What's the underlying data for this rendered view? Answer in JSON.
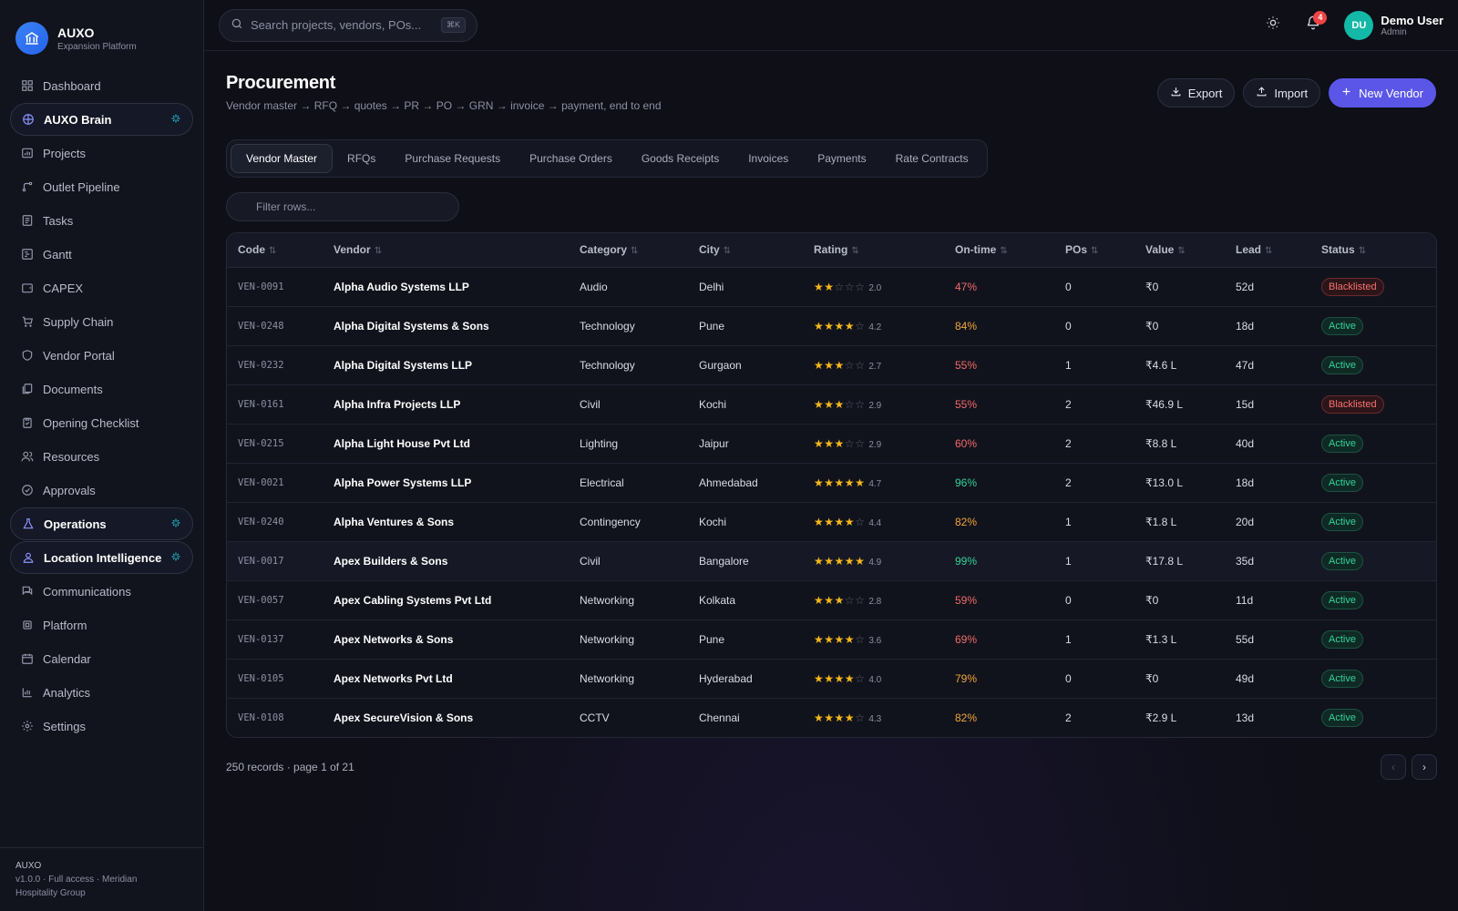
{
  "brand": {
    "name": "AUXO",
    "subtitle": "Expansion Platform"
  },
  "sidebar": {
    "items": [
      {
        "label": "Dashboard",
        "icon": "grid-icon"
      },
      {
        "label": "AUXO Brain",
        "icon": "brain-icon",
        "accent": true
      },
      {
        "label": "Projects",
        "icon": "projects-icon"
      },
      {
        "label": "Outlet Pipeline",
        "icon": "pipeline-icon"
      },
      {
        "label": "Tasks",
        "icon": "tasks-icon"
      },
      {
        "label": "Gantt",
        "icon": "gantt-icon"
      },
      {
        "label": "CAPEX",
        "icon": "wallet-icon"
      },
      {
        "label": "Supply Chain",
        "icon": "cart-icon"
      },
      {
        "label": "Vendor Portal",
        "icon": "shield-icon"
      },
      {
        "label": "Documents",
        "icon": "documents-icon"
      },
      {
        "label": "Opening Checklist",
        "icon": "clipboard-icon"
      },
      {
        "label": "Resources",
        "icon": "users-icon"
      },
      {
        "label": "Approvals",
        "icon": "check-circle-icon"
      },
      {
        "label": "Operations",
        "icon": "flask-icon",
        "accent": true
      },
      {
        "label": "Location Intelligence",
        "icon": "user-pin-icon",
        "accent": true
      },
      {
        "label": "Communications",
        "icon": "chat-icon"
      },
      {
        "label": "Platform",
        "icon": "chip-icon"
      },
      {
        "label": "Calendar",
        "icon": "calendar-icon"
      },
      {
        "label": "Analytics",
        "icon": "bar-chart-icon"
      },
      {
        "label": "Settings",
        "icon": "gear-icon"
      }
    ],
    "footer": {
      "name": "AUXO",
      "line1": "v1.0.0 · Full access · Meridian",
      "line2": "Hospitality Group"
    }
  },
  "topbar": {
    "search_placeholder": "Search projects, vendors, POs...",
    "search_shortcut": "⌘K",
    "notification_count": "4",
    "user": {
      "initials": "DU",
      "name": "Demo User",
      "role": "Admin"
    }
  },
  "page": {
    "title": "Procurement",
    "subtitle": "Vendor master → RFQ → quotes → PR → PO → GRN → invoice → payment, end to end",
    "actions": {
      "export": "Export",
      "import": "Import",
      "new": "New Vendor"
    },
    "tabs": [
      "Vendor Master",
      "RFQs",
      "Purchase Requests",
      "Purchase Orders",
      "Goods Receipts",
      "Invoices",
      "Payments",
      "Rate Contracts"
    ],
    "active_tab": 0,
    "filter_placeholder": "Filter rows...",
    "footer_text": "250 records · page 1 of 21"
  },
  "table": {
    "columns": [
      "Code",
      "Vendor",
      "Category",
      "City",
      "Rating",
      "On-time",
      "POs",
      "Value",
      "Lead",
      "Status"
    ],
    "rows": [
      {
        "code": "VEN-0091",
        "vendor": "Alpha Audio Systems LLP",
        "category": "Audio",
        "city": "Delhi",
        "stars": 2,
        "rating": "2.0",
        "ontime": "47%",
        "ontime_level": "red",
        "pos": "0",
        "value": "₹0",
        "lead": "52d",
        "status": "Blacklisted"
      },
      {
        "code": "VEN-0248",
        "vendor": "Alpha Digital Systems & Sons",
        "category": "Technology",
        "city": "Pune",
        "stars": 4,
        "rating": "4.2",
        "ontime": "84%",
        "ontime_level": "amber",
        "pos": "0",
        "value": "₹0",
        "lead": "18d",
        "status": "Active"
      },
      {
        "code": "VEN-0232",
        "vendor": "Alpha Digital Systems LLP",
        "category": "Technology",
        "city": "Gurgaon",
        "stars": 3,
        "rating": "2.7",
        "ontime": "55%",
        "ontime_level": "red",
        "pos": "1",
        "value": "₹4.6 L",
        "lead": "47d",
        "status": "Active"
      },
      {
        "code": "VEN-0161",
        "vendor": "Alpha Infra Projects LLP",
        "category": "Civil",
        "city": "Kochi",
        "stars": 3,
        "rating": "2.9",
        "ontime": "55%",
        "ontime_level": "red",
        "pos": "2",
        "value": "₹46.9 L",
        "lead": "15d",
        "status": "Blacklisted"
      },
      {
        "code": "VEN-0215",
        "vendor": "Alpha Light House Pvt Ltd",
        "category": "Lighting",
        "city": "Jaipur",
        "stars": 3,
        "rating": "2.9",
        "ontime": "60%",
        "ontime_level": "red",
        "pos": "2",
        "value": "₹8.8 L",
        "lead": "40d",
        "status": "Active"
      },
      {
        "code": "VEN-0021",
        "vendor": "Alpha Power Systems LLP",
        "category": "Electrical",
        "city": "Ahmedabad",
        "stars": 5,
        "rating": "4.7",
        "ontime": "96%",
        "ontime_level": "green",
        "pos": "2",
        "value": "₹13.0 L",
        "lead": "18d",
        "status": "Active"
      },
      {
        "code": "VEN-0240",
        "vendor": "Alpha Ventures & Sons",
        "category": "Contingency",
        "city": "Kochi",
        "stars": 4,
        "rating": "4.4",
        "ontime": "82%",
        "ontime_level": "amber",
        "pos": "1",
        "value": "₹1.8 L",
        "lead": "20d",
        "status": "Active"
      },
      {
        "code": "VEN-0017",
        "vendor": "Apex Builders & Sons",
        "category": "Civil",
        "city": "Bangalore",
        "stars": 5,
        "rating": "4.9",
        "ontime": "99%",
        "ontime_level": "green",
        "pos": "1",
        "value": "₹17.8 L",
        "lead": "35d",
        "status": "Active",
        "highlight": true
      },
      {
        "code": "VEN-0057",
        "vendor": "Apex Cabling Systems Pvt Ltd",
        "category": "Networking",
        "city": "Kolkata",
        "stars": 3,
        "rating": "2.8",
        "ontime": "59%",
        "ontime_level": "red",
        "pos": "0",
        "value": "₹0",
        "lead": "11d",
        "status": "Active"
      },
      {
        "code": "VEN-0137",
        "vendor": "Apex Networks & Sons",
        "category": "Networking",
        "city": "Pune",
        "stars": 4,
        "rating": "3.6",
        "ontime": "69%",
        "ontime_level": "red",
        "pos": "1",
        "value": "₹1.3 L",
        "lead": "55d",
        "status": "Active"
      },
      {
        "code": "VEN-0105",
        "vendor": "Apex Networks Pvt Ltd",
        "category": "Networking",
        "city": "Hyderabad",
        "stars": 4,
        "rating": "4.0",
        "ontime": "79%",
        "ontime_level": "amber",
        "pos": "0",
        "value": "₹0",
        "lead": "49d",
        "status": "Active"
      },
      {
        "code": "VEN-0108",
        "vendor": "Apex SecureVision & Sons",
        "category": "CCTV",
        "city": "Chennai",
        "stars": 4,
        "rating": "4.3",
        "ontime": "82%",
        "ontime_level": "amber",
        "pos": "2",
        "value": "₹2.9 L",
        "lead": "13d",
        "status": "Active"
      }
    ]
  },
  "colors": {
    "accent": "#5b56e8",
    "active": "#34d399",
    "blacklisted": "#f87171",
    "star": "#f5b81c"
  }
}
